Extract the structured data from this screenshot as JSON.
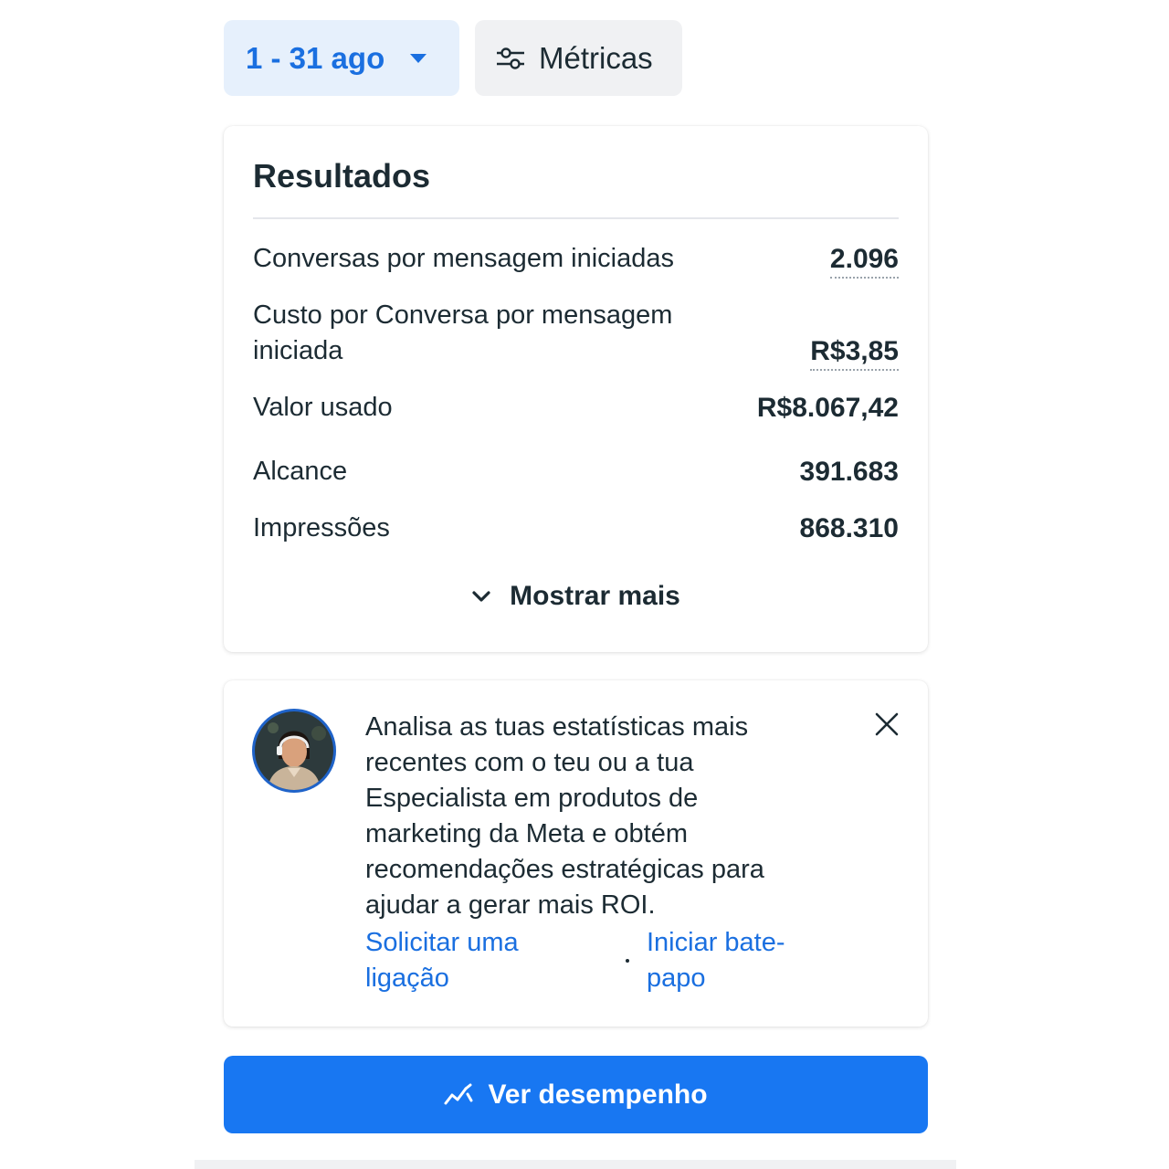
{
  "filters": {
    "date_range": "1 - 31 ago",
    "metrics_label": "Métricas"
  },
  "results": {
    "title": "Resultados",
    "rows": [
      {
        "label": "Conversas por mensagem iniciadas",
        "value": "2.096"
      },
      {
        "label": "Custo por Conversa por mensagem iniciada",
        "value": "R$3,85"
      },
      {
        "label": "Valor usado",
        "value": "R$8.067,42"
      },
      {
        "label": "Alcance",
        "value": "391.683"
      },
      {
        "label": "Impressões",
        "value": "868.310"
      }
    ],
    "show_more": "Mostrar mais"
  },
  "promo": {
    "text": "Analisa as tuas estatísticas mais recentes com o teu ou a tua Especialista em produtos de marketing da Meta e obtém recomendações estratégicas para ajudar a gerar mais ROI.",
    "link_call": "Solicitar uma ligação",
    "link_chat": "Iniciar bate-papo"
  },
  "actions": {
    "performance_label": "Ver desempenho"
  },
  "icons": {
    "date_caret": "caret-down-icon",
    "metrics": "sliders-icon",
    "show_more": "chevron-down-icon",
    "close": "close-icon",
    "performance": "trend-line-icon"
  },
  "colors": {
    "accent": "#1877f2",
    "link": "#1a6fe0",
    "date_bg": "#e6f0fc",
    "text": "#1c2b33"
  }
}
